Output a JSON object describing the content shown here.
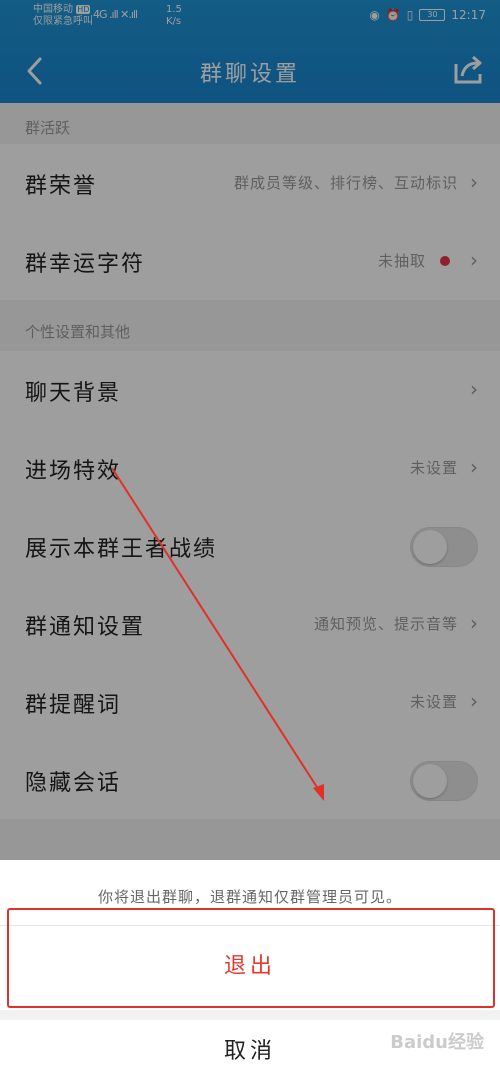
{
  "status_bar": {
    "carrier": "中国移动",
    "carrier_badge": "HD",
    "carrier_note": "仅限紧急呼叫",
    "signal": "4G .ıll ✕.ıll",
    "speed_value": "1.5",
    "speed_unit": "K/s",
    "battery": "30",
    "time": "12:17"
  },
  "header": {
    "title": "群聊设置"
  },
  "sections": {
    "activity": "群活跃",
    "personal": "个性设置和其他"
  },
  "rows": {
    "honor": {
      "label": "群荣誉",
      "value": "群成员等级、排行榜、互动标识"
    },
    "lucky": {
      "label": "群幸运字符",
      "value": "未抽取"
    },
    "background": {
      "label": "聊天背景"
    },
    "entrance": {
      "label": "进场特效",
      "value": "未设置"
    },
    "king_glory": {
      "label": "展示本群王者战绩",
      "toggle": false
    },
    "notify": {
      "label": "群通知设置",
      "value": "通知预览、提示音等"
    },
    "reminder": {
      "label": "群提醒词",
      "value": "未设置"
    },
    "hide_chat": {
      "label": "隐藏会话",
      "toggle": false
    }
  },
  "sheet": {
    "message": "你将退出群聊，退群通知仅群管理员可见。",
    "exit_label": "退出",
    "cancel_label": "取消",
    "watermark": "Baidu经验"
  },
  "colors": {
    "header_blue": "#1e95d8",
    "exit_red": "#e33b2e",
    "annotation_red": "#e0302a",
    "dot_red": "#e8344a"
  },
  "icons": {
    "back": "chevron-left-icon",
    "share": "share-icon",
    "row_chevron": "chevron-right-icon"
  }
}
